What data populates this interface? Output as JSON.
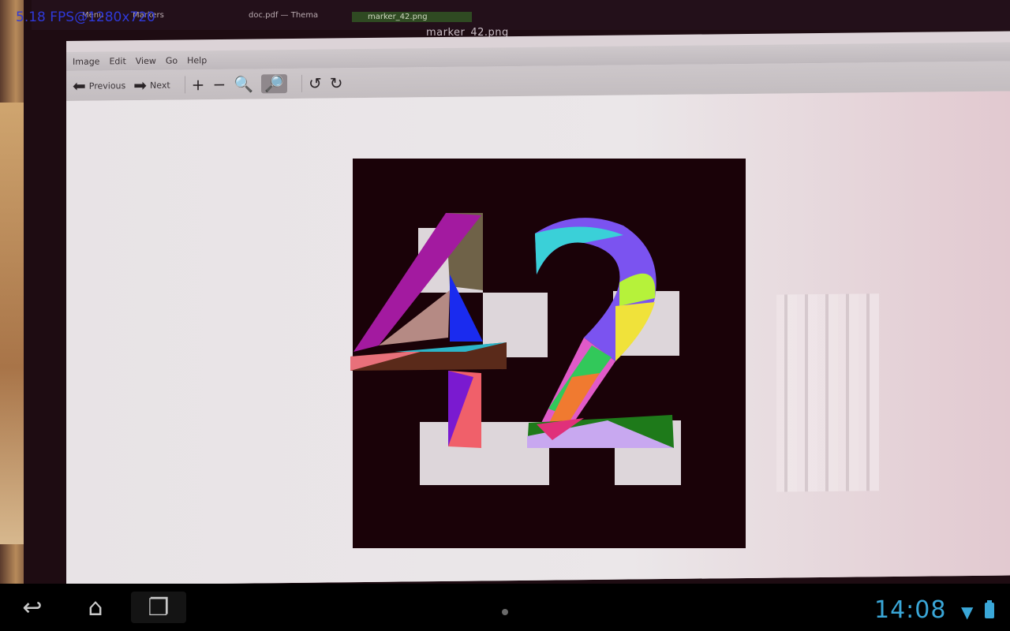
{
  "overlay": {
    "fps_text": "5.18 FPS@1280x720"
  },
  "desktop_panel": {
    "tabs": [
      "Menu",
      "Markers",
      "doc.pdf — Thema"
    ],
    "active_tab": "marker_42.png"
  },
  "viewer": {
    "window_title": "marker_42.png",
    "menu": [
      "Image",
      "Edit",
      "View",
      "Go",
      "Help"
    ],
    "toolbar": {
      "previous_label": "Previous",
      "next_label": "Next"
    }
  },
  "statusbar": {
    "clock": "14:08"
  },
  "icons": {
    "back": "back-icon",
    "home": "home-icon",
    "recent": "recent-apps-icon",
    "wifi": "wifi-icon",
    "battery": "battery-icon",
    "zoom_in": "zoom-in-icon",
    "zoom_out": "zoom-out-icon",
    "zoom_normal": "zoom-normal-icon",
    "zoom_fit": "zoom-fit-icon",
    "rotate_left": "rotate-left-icon",
    "rotate_right": "rotate-right-icon"
  },
  "colors": {
    "clock": "#3aa7d8",
    "fps": "#2f39d8",
    "marker": "#1a0208"
  }
}
